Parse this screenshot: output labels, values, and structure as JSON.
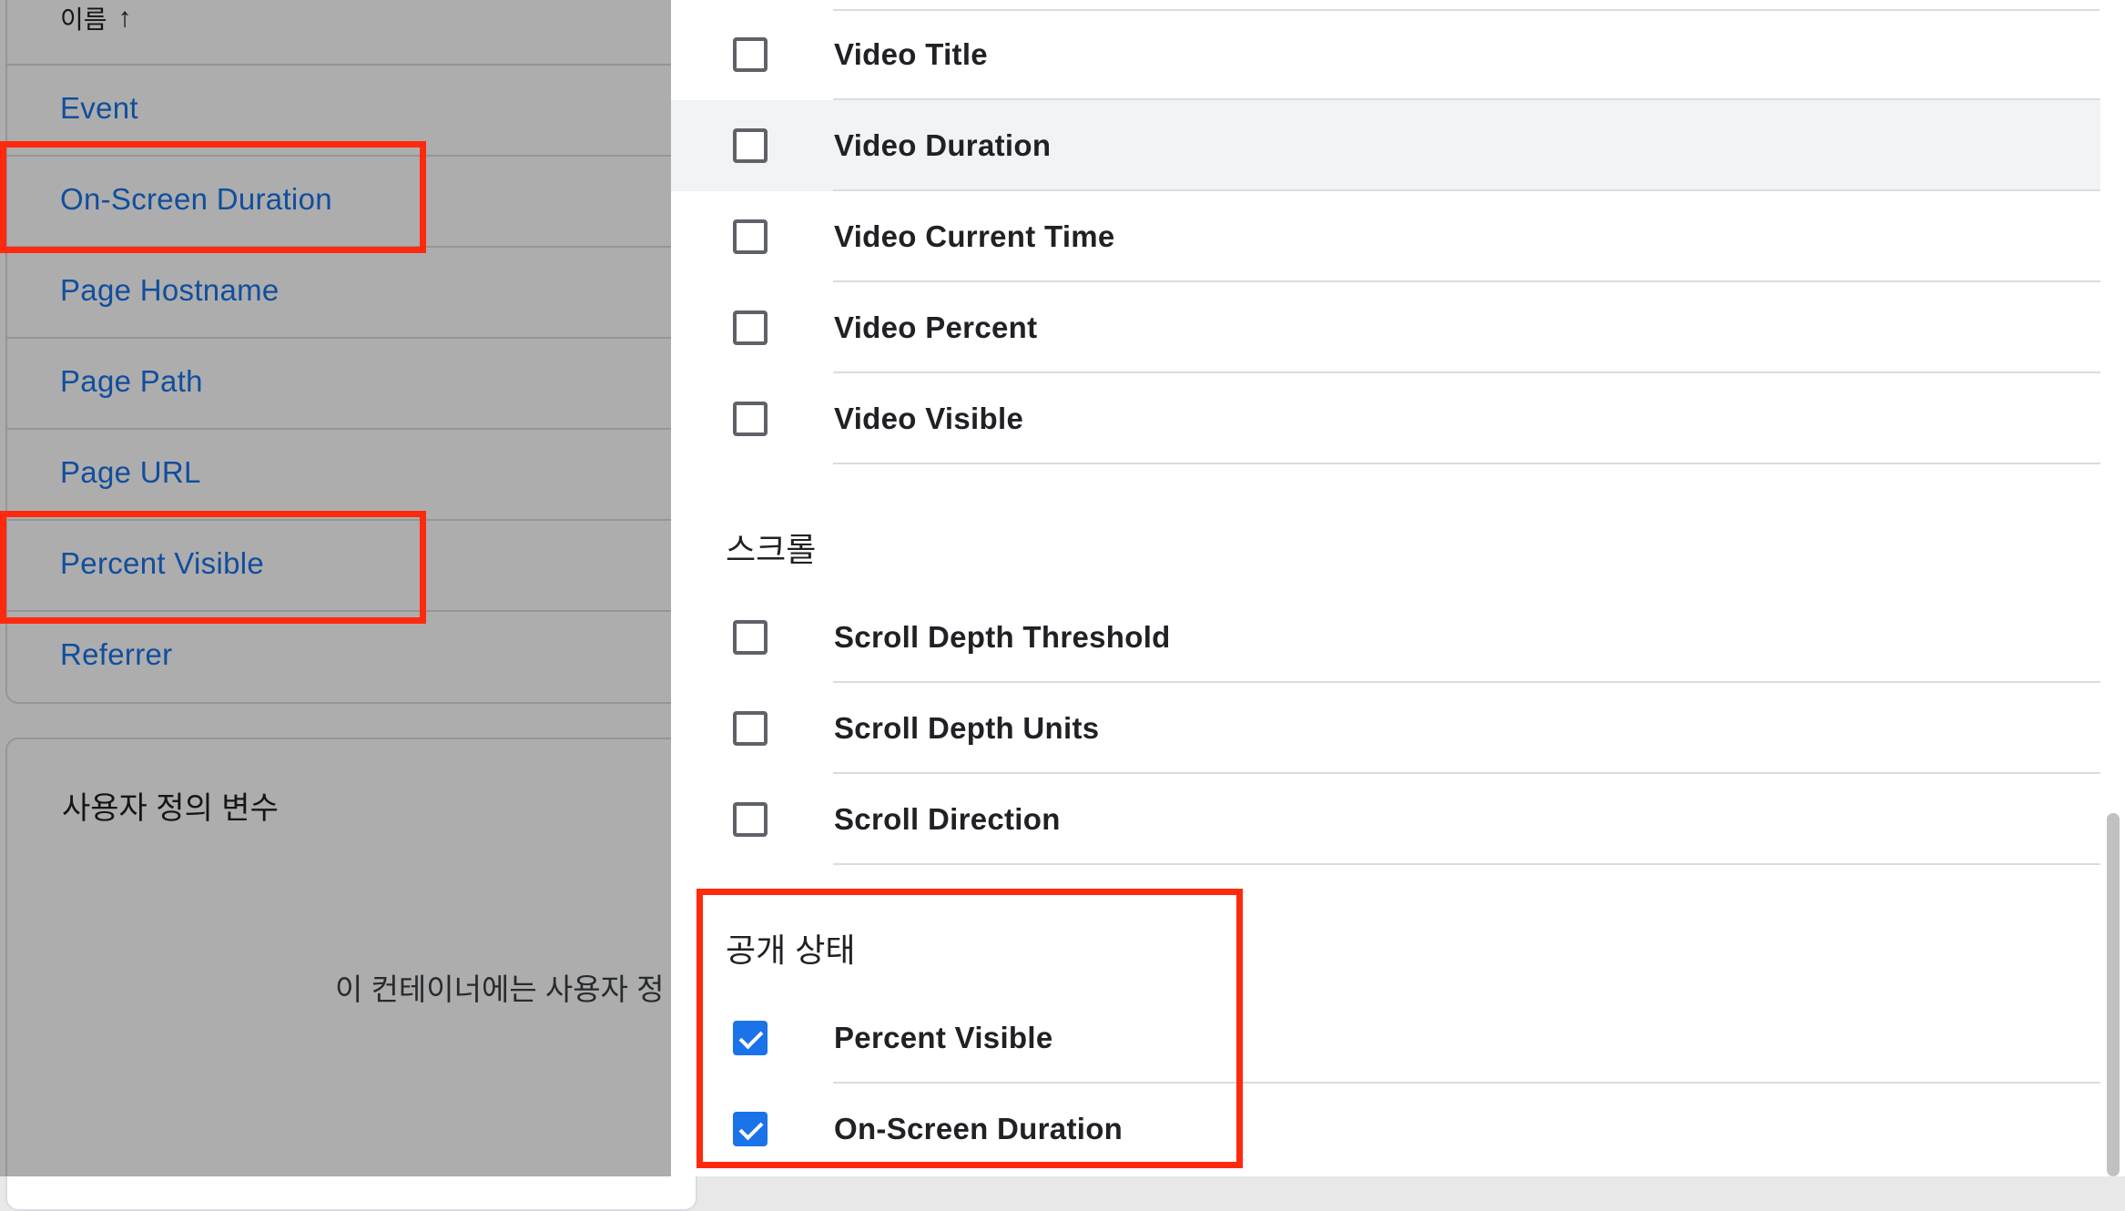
{
  "builtin_list": {
    "sort_header": "이름",
    "sort_icon": "arrow-up-icon",
    "items": [
      "Event",
      "On-Screen Duration",
      "Page Hostname",
      "Page Path",
      "Page URL",
      "Percent Visible",
      "Referrer"
    ]
  },
  "custom_variables": {
    "title": "사용자 정의 변수",
    "empty_text": "이 컨테이너에는 사용자 정"
  },
  "panel": {
    "video_rows": [
      {
        "label": "Video Title",
        "checked": false
      },
      {
        "label": "Video Duration",
        "checked": false
      },
      {
        "label": "Video Current Time",
        "checked": false
      },
      {
        "label": "Video Percent",
        "checked": false
      },
      {
        "label": "Video Visible",
        "checked": false
      }
    ],
    "scroll_section": {
      "title": "스크롤",
      "rows": [
        {
          "label": "Scroll Depth Threshold",
          "checked": false
        },
        {
          "label": "Scroll Depth Units",
          "checked": false
        },
        {
          "label": "Scroll Direction",
          "checked": false
        }
      ]
    },
    "visibility_section": {
      "title": "공개 상태",
      "rows": [
        {
          "label": "Percent Visible",
          "checked": true
        },
        {
          "label": "On-Screen Duration",
          "checked": true
        }
      ]
    }
  },
  "colors": {
    "link": "#1a73e8",
    "checkbox_checked": "#1a73e8",
    "highlight": "#ff2a0e"
  }
}
